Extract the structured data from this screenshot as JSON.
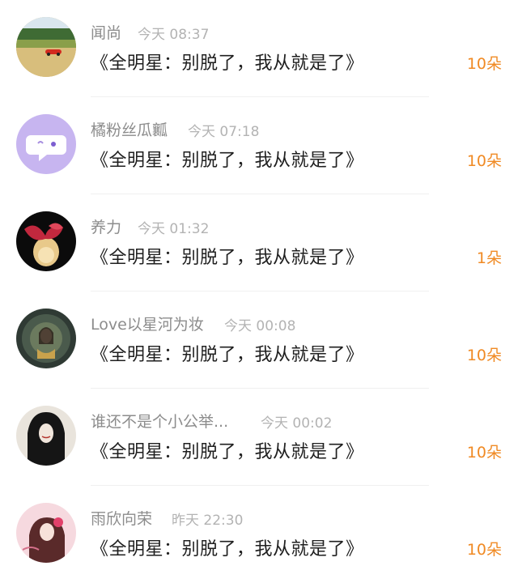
{
  "list": {
    "items": [
      {
        "name": "闻尚",
        "time": "今天 08:37",
        "title": "《全明星：别脱了，我从就是了》",
        "count": "10朵",
        "avatar": "landscape-car-avatar"
      },
      {
        "name": "橘粉丝瓜瓤",
        "time": "今天 07:18",
        "title": "《全明星：别脱了，我从就是了》",
        "count": "10朵",
        "avatar": "chat-bubble-avatar"
      },
      {
        "name": "养力",
        "time": "今天 01:32",
        "title": "《全明星：别脱了，我从就是了》",
        "count": "1朵",
        "avatar": "flower-vase-avatar"
      },
      {
        "name": "Love以星河为妆",
        "time": "今天 00:08",
        "title": "《全明星：别脱了，我从就是了》",
        "count": "10朵",
        "avatar": "fantasy-girl-avatar"
      },
      {
        "name": "谁还不是个小公举...",
        "time": "今天 00:02",
        "title": "《全明星：别脱了，我从就是了》",
        "count": "10朵",
        "avatar": "ink-girl-avatar"
      },
      {
        "name": "雨欣向荣",
        "time": "昨天 22:30",
        "title": "《全明星：别脱了，我从就是了》",
        "count": "10朵",
        "avatar": "pink-girl-avatar"
      }
    ]
  },
  "colors": {
    "accent": "#f08a24",
    "name": "#8c8c8c",
    "time": "#b3b3b3"
  }
}
